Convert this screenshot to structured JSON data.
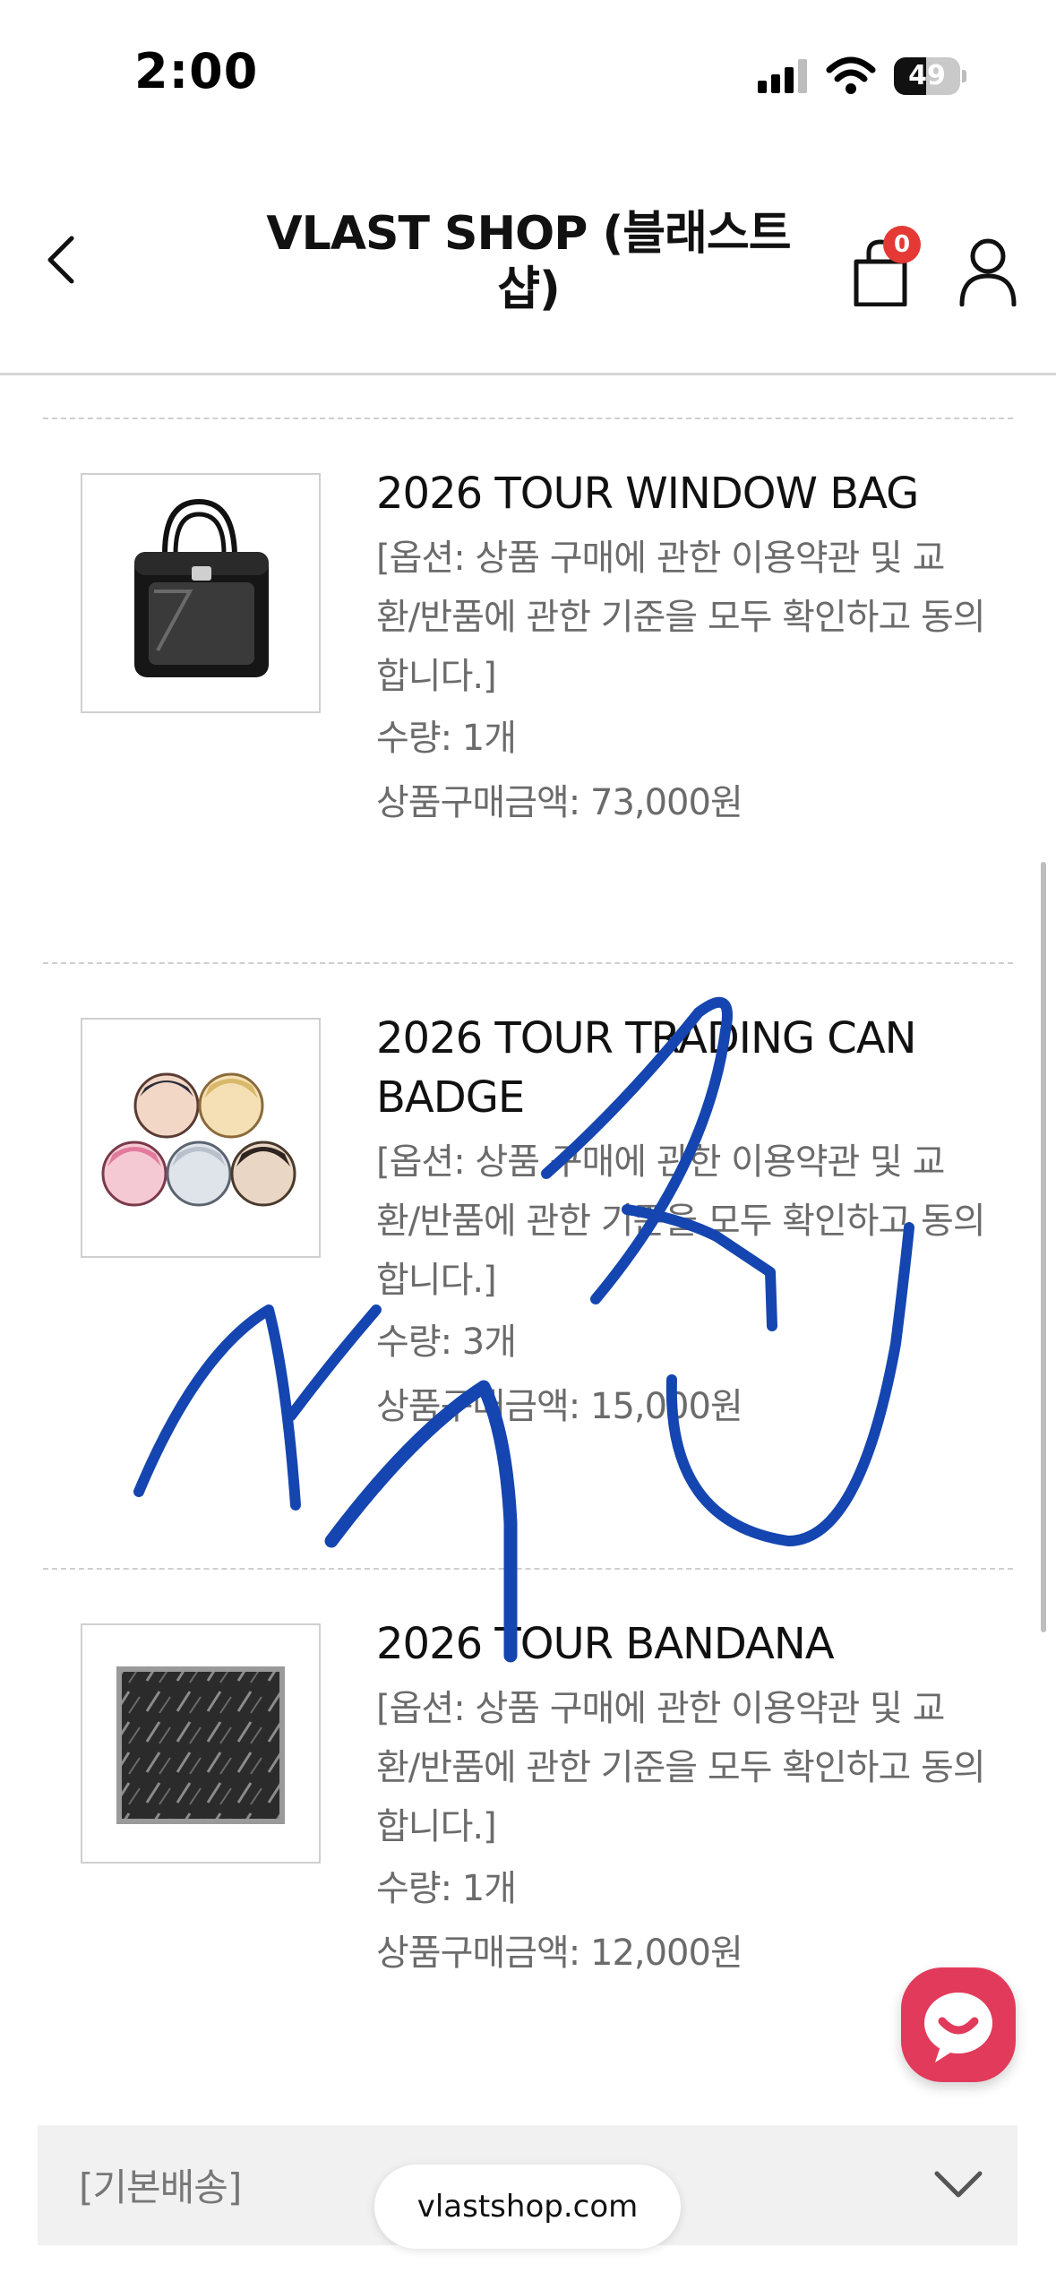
{
  "status_bar": {
    "time": "2:00",
    "battery_level": "49",
    "battery_percent": 49
  },
  "header": {
    "title": "VLAST SHOP (블래스트 샵)",
    "cart_count": "0"
  },
  "items": [
    {
      "name": "2026 TOUR WINDOW BAG",
      "option": "[옵션: 상품 구매에 관한 이용약관 및 교환/반품에 관한 기준을 모두 확인하고 동의합니다.]",
      "quantity": "수량: 1개",
      "price": "상품구매금액: 73,000원"
    },
    {
      "name": "2026 TOUR TRADING CAN BADGE",
      "option": "[옵션: 상품 구매에 관한 이용약관 및 교환/반품에 관한 기준을 모두 확인하고 동의합니다.]",
      "quantity": "수량: 3개",
      "price": "상품구매금액: 15,000원"
    },
    {
      "name": "2026 TOUR BANDANA",
      "option": "[옵션: 상품 구매에 관한 이용약관 및 교환/반품에 관한 기준을 모두 확인하고 동의합니다.]",
      "quantity": "수량: 1개",
      "price": "상품구매금액: 12,000원"
    }
  ],
  "shipping": {
    "label": "[기본배송]"
  },
  "browser": {
    "url": "vlastshop.com"
  },
  "colors": {
    "accent_badge": "#e53935",
    "chat_button": "#e23a5b",
    "scribble_ink": "#1545b0"
  },
  "icons": {
    "back": "chevron-left-icon",
    "cart": "shopping-bag-icon",
    "user": "user-icon",
    "chat": "chat-icon",
    "expand": "chevron-down-icon"
  }
}
